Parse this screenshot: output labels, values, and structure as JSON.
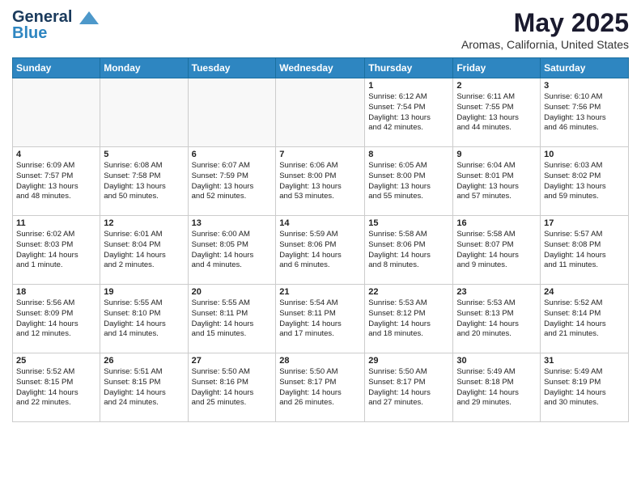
{
  "header": {
    "logo_line1": "General",
    "logo_line2": "Blue",
    "title": "May 2025",
    "subtitle": "Aromas, California, United States"
  },
  "days_of_week": [
    "Sunday",
    "Monday",
    "Tuesday",
    "Wednesday",
    "Thursday",
    "Friday",
    "Saturday"
  ],
  "weeks": [
    [
      {
        "day": "",
        "info": ""
      },
      {
        "day": "",
        "info": ""
      },
      {
        "day": "",
        "info": ""
      },
      {
        "day": "",
        "info": ""
      },
      {
        "day": "1",
        "info": "Sunrise: 6:12 AM\nSunset: 7:54 PM\nDaylight: 13 hours\nand 42 minutes."
      },
      {
        "day": "2",
        "info": "Sunrise: 6:11 AM\nSunset: 7:55 PM\nDaylight: 13 hours\nand 44 minutes."
      },
      {
        "day": "3",
        "info": "Sunrise: 6:10 AM\nSunset: 7:56 PM\nDaylight: 13 hours\nand 46 minutes."
      }
    ],
    [
      {
        "day": "4",
        "info": "Sunrise: 6:09 AM\nSunset: 7:57 PM\nDaylight: 13 hours\nand 48 minutes."
      },
      {
        "day": "5",
        "info": "Sunrise: 6:08 AM\nSunset: 7:58 PM\nDaylight: 13 hours\nand 50 minutes."
      },
      {
        "day": "6",
        "info": "Sunrise: 6:07 AM\nSunset: 7:59 PM\nDaylight: 13 hours\nand 52 minutes."
      },
      {
        "day": "7",
        "info": "Sunrise: 6:06 AM\nSunset: 8:00 PM\nDaylight: 13 hours\nand 53 minutes."
      },
      {
        "day": "8",
        "info": "Sunrise: 6:05 AM\nSunset: 8:00 PM\nDaylight: 13 hours\nand 55 minutes."
      },
      {
        "day": "9",
        "info": "Sunrise: 6:04 AM\nSunset: 8:01 PM\nDaylight: 13 hours\nand 57 minutes."
      },
      {
        "day": "10",
        "info": "Sunrise: 6:03 AM\nSunset: 8:02 PM\nDaylight: 13 hours\nand 59 minutes."
      }
    ],
    [
      {
        "day": "11",
        "info": "Sunrise: 6:02 AM\nSunset: 8:03 PM\nDaylight: 14 hours\nand 1 minute."
      },
      {
        "day": "12",
        "info": "Sunrise: 6:01 AM\nSunset: 8:04 PM\nDaylight: 14 hours\nand 2 minutes."
      },
      {
        "day": "13",
        "info": "Sunrise: 6:00 AM\nSunset: 8:05 PM\nDaylight: 14 hours\nand 4 minutes."
      },
      {
        "day": "14",
        "info": "Sunrise: 5:59 AM\nSunset: 8:06 PM\nDaylight: 14 hours\nand 6 minutes."
      },
      {
        "day": "15",
        "info": "Sunrise: 5:58 AM\nSunset: 8:06 PM\nDaylight: 14 hours\nand 8 minutes."
      },
      {
        "day": "16",
        "info": "Sunrise: 5:58 AM\nSunset: 8:07 PM\nDaylight: 14 hours\nand 9 minutes."
      },
      {
        "day": "17",
        "info": "Sunrise: 5:57 AM\nSunset: 8:08 PM\nDaylight: 14 hours\nand 11 minutes."
      }
    ],
    [
      {
        "day": "18",
        "info": "Sunrise: 5:56 AM\nSunset: 8:09 PM\nDaylight: 14 hours\nand 12 minutes."
      },
      {
        "day": "19",
        "info": "Sunrise: 5:55 AM\nSunset: 8:10 PM\nDaylight: 14 hours\nand 14 minutes."
      },
      {
        "day": "20",
        "info": "Sunrise: 5:55 AM\nSunset: 8:11 PM\nDaylight: 14 hours\nand 15 minutes."
      },
      {
        "day": "21",
        "info": "Sunrise: 5:54 AM\nSunset: 8:11 PM\nDaylight: 14 hours\nand 17 minutes."
      },
      {
        "day": "22",
        "info": "Sunrise: 5:53 AM\nSunset: 8:12 PM\nDaylight: 14 hours\nand 18 minutes."
      },
      {
        "day": "23",
        "info": "Sunrise: 5:53 AM\nSunset: 8:13 PM\nDaylight: 14 hours\nand 20 minutes."
      },
      {
        "day": "24",
        "info": "Sunrise: 5:52 AM\nSunset: 8:14 PM\nDaylight: 14 hours\nand 21 minutes."
      }
    ],
    [
      {
        "day": "25",
        "info": "Sunrise: 5:52 AM\nSunset: 8:15 PM\nDaylight: 14 hours\nand 22 minutes."
      },
      {
        "day": "26",
        "info": "Sunrise: 5:51 AM\nSunset: 8:15 PM\nDaylight: 14 hours\nand 24 minutes."
      },
      {
        "day": "27",
        "info": "Sunrise: 5:50 AM\nSunset: 8:16 PM\nDaylight: 14 hours\nand 25 minutes."
      },
      {
        "day": "28",
        "info": "Sunrise: 5:50 AM\nSunset: 8:17 PM\nDaylight: 14 hours\nand 26 minutes."
      },
      {
        "day": "29",
        "info": "Sunrise: 5:50 AM\nSunset: 8:17 PM\nDaylight: 14 hours\nand 27 minutes."
      },
      {
        "day": "30",
        "info": "Sunrise: 5:49 AM\nSunset: 8:18 PM\nDaylight: 14 hours\nand 29 minutes."
      },
      {
        "day": "31",
        "info": "Sunrise: 5:49 AM\nSunset: 8:19 PM\nDaylight: 14 hours\nand 30 minutes."
      }
    ]
  ]
}
